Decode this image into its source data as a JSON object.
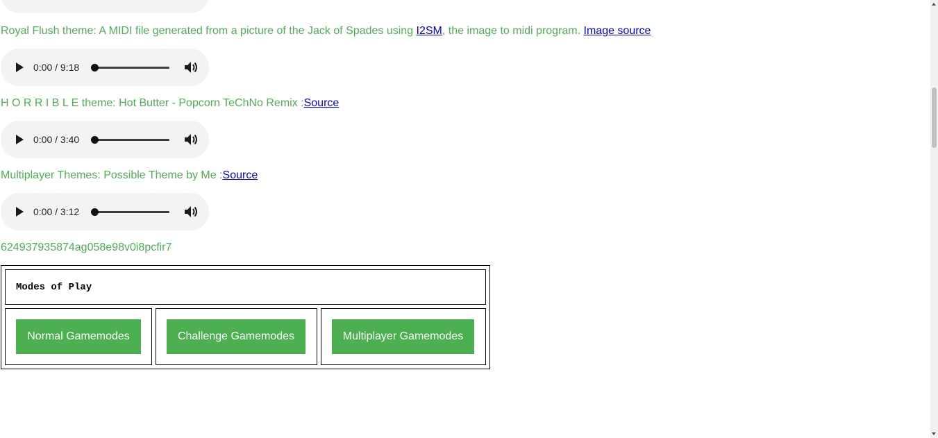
{
  "players": [
    {
      "time": "0:00 / 9:18"
    },
    {
      "time": "0:00 / 3:40"
    },
    {
      "time": "0:00 / 3:12"
    }
  ],
  "themes": {
    "royal_flush": {
      "text": "Royal Flush theme: A MIDI file generated from a picture of the Jack of Spades using ",
      "link1": "I2SM",
      "text2": ", the image to midi program. ",
      "link2": "Image source"
    },
    "horrible": {
      "text": "H O R R I B L E theme: Hot Butter - Popcorn TeChNo Remix :",
      "link": "Source"
    },
    "multiplayer": {
      "text": "Multiplayer Themes: Possible Theme by Me :",
      "link": "Source"
    }
  },
  "code_string": "624937935874ag058e98v0i8pcfir7",
  "modes": {
    "title": "Modes of Play",
    "buttons": [
      "Normal Gamemodes",
      "Challenge Gamemodes",
      "Multiplayer Gamemodes"
    ]
  },
  "colors": {
    "text_green": "#4cb050",
    "button_green": "#4caf50",
    "link_blue": "#0000ee",
    "player_bg": "#f1f3f4"
  }
}
